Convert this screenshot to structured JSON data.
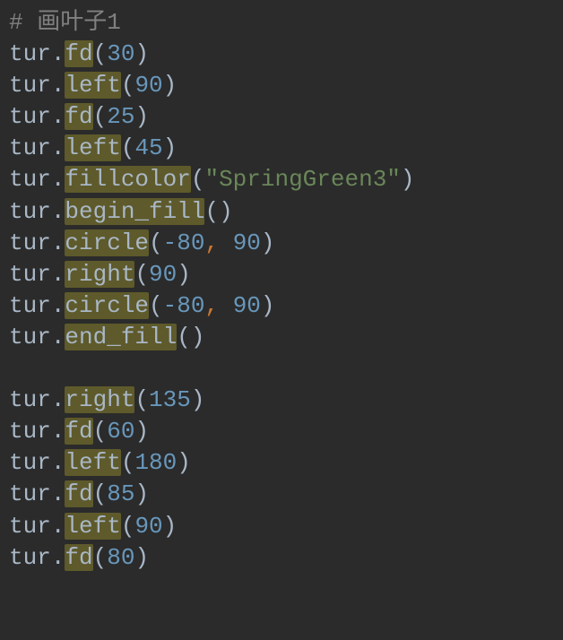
{
  "code": {
    "lines": [
      {
        "tokens": [
          {
            "t": "# 画叶子1",
            "c": "comment"
          }
        ]
      },
      {
        "tokens": [
          {
            "t": "tur",
            "c": "ident"
          },
          {
            "t": ".",
            "c": "dot"
          },
          {
            "t": "fd",
            "c": "method"
          },
          {
            "t": "(",
            "c": "paren"
          },
          {
            "t": "30",
            "c": "number"
          },
          {
            "t": ")",
            "c": "paren"
          }
        ]
      },
      {
        "tokens": [
          {
            "t": "tur",
            "c": "ident"
          },
          {
            "t": ".",
            "c": "dot"
          },
          {
            "t": "left",
            "c": "method"
          },
          {
            "t": "(",
            "c": "paren"
          },
          {
            "t": "90",
            "c": "number"
          },
          {
            "t": ")",
            "c": "paren"
          }
        ]
      },
      {
        "tokens": [
          {
            "t": "tur",
            "c": "ident"
          },
          {
            "t": ".",
            "c": "dot"
          },
          {
            "t": "fd",
            "c": "method"
          },
          {
            "t": "(",
            "c": "paren"
          },
          {
            "t": "25",
            "c": "number"
          },
          {
            "t": ")",
            "c": "paren"
          }
        ]
      },
      {
        "tokens": [
          {
            "t": "tur",
            "c": "ident"
          },
          {
            "t": ".",
            "c": "dot"
          },
          {
            "t": "left",
            "c": "method"
          },
          {
            "t": "(",
            "c": "paren"
          },
          {
            "t": "45",
            "c": "number"
          },
          {
            "t": ")",
            "c": "paren"
          }
        ]
      },
      {
        "tokens": [
          {
            "t": "tur",
            "c": "ident"
          },
          {
            "t": ".",
            "c": "dot"
          },
          {
            "t": "fillcolor",
            "c": "method"
          },
          {
            "t": "(",
            "c": "paren"
          },
          {
            "t": "\"SpringGreen3\"",
            "c": "string"
          },
          {
            "t": ")",
            "c": "paren"
          }
        ]
      },
      {
        "tokens": [
          {
            "t": "tur",
            "c": "ident"
          },
          {
            "t": ".",
            "c": "dot"
          },
          {
            "t": "begin_fill",
            "c": "method"
          },
          {
            "t": "(",
            "c": "paren"
          },
          {
            "t": ")",
            "c": "paren"
          }
        ]
      },
      {
        "tokens": [
          {
            "t": "tur",
            "c": "ident"
          },
          {
            "t": ".",
            "c": "dot"
          },
          {
            "t": "circle",
            "c": "method"
          },
          {
            "t": "(",
            "c": "paren"
          },
          {
            "t": "-80",
            "c": "number"
          },
          {
            "t": ",",
            "c": "comma"
          },
          {
            "t": " ",
            "c": "ident"
          },
          {
            "t": "90",
            "c": "number"
          },
          {
            "t": ")",
            "c": "paren"
          }
        ]
      },
      {
        "tokens": [
          {
            "t": "tur",
            "c": "ident"
          },
          {
            "t": ".",
            "c": "dot"
          },
          {
            "t": "right",
            "c": "method"
          },
          {
            "t": "(",
            "c": "paren"
          },
          {
            "t": "90",
            "c": "number"
          },
          {
            "t": ")",
            "c": "paren"
          }
        ]
      },
      {
        "tokens": [
          {
            "t": "tur",
            "c": "ident"
          },
          {
            "t": ".",
            "c": "dot"
          },
          {
            "t": "circle",
            "c": "method"
          },
          {
            "t": "(",
            "c": "paren"
          },
          {
            "t": "-80",
            "c": "number"
          },
          {
            "t": ",",
            "c": "comma"
          },
          {
            "t": " ",
            "c": "ident"
          },
          {
            "t": "90",
            "c": "number"
          },
          {
            "t": ")",
            "c": "paren"
          }
        ]
      },
      {
        "tokens": [
          {
            "t": "tur",
            "c": "ident"
          },
          {
            "t": ".",
            "c": "dot"
          },
          {
            "t": "end_fill",
            "c": "method"
          },
          {
            "t": "(",
            "c": "paren"
          },
          {
            "t": ")",
            "c": "paren"
          }
        ]
      },
      {
        "tokens": [
          {
            "t": " ",
            "c": "ident"
          }
        ]
      },
      {
        "tokens": [
          {
            "t": "tur",
            "c": "ident"
          },
          {
            "t": ".",
            "c": "dot"
          },
          {
            "t": "right",
            "c": "method"
          },
          {
            "t": "(",
            "c": "paren"
          },
          {
            "t": "135",
            "c": "number"
          },
          {
            "t": ")",
            "c": "paren"
          }
        ]
      },
      {
        "tokens": [
          {
            "t": "tur",
            "c": "ident"
          },
          {
            "t": ".",
            "c": "dot"
          },
          {
            "t": "fd",
            "c": "method"
          },
          {
            "t": "(",
            "c": "paren"
          },
          {
            "t": "60",
            "c": "number"
          },
          {
            "t": ")",
            "c": "paren"
          }
        ]
      },
      {
        "tokens": [
          {
            "t": "tur",
            "c": "ident"
          },
          {
            "t": ".",
            "c": "dot"
          },
          {
            "t": "left",
            "c": "method"
          },
          {
            "t": "(",
            "c": "paren"
          },
          {
            "t": "180",
            "c": "number"
          },
          {
            "t": ")",
            "c": "paren"
          }
        ]
      },
      {
        "tokens": [
          {
            "t": "tur",
            "c": "ident"
          },
          {
            "t": ".",
            "c": "dot"
          },
          {
            "t": "fd",
            "c": "method"
          },
          {
            "t": "(",
            "c": "paren"
          },
          {
            "t": "85",
            "c": "number"
          },
          {
            "t": ")",
            "c": "paren"
          }
        ]
      },
      {
        "tokens": [
          {
            "t": "tur",
            "c": "ident"
          },
          {
            "t": ".",
            "c": "dot"
          },
          {
            "t": "left",
            "c": "method"
          },
          {
            "t": "(",
            "c": "paren"
          },
          {
            "t": "90",
            "c": "number"
          },
          {
            "t": ")",
            "c": "paren"
          }
        ]
      },
      {
        "tokens": [
          {
            "t": "tur",
            "c": "ident"
          },
          {
            "t": ".",
            "c": "dot"
          },
          {
            "t": "fd",
            "c": "method"
          },
          {
            "t": "(",
            "c": "paren"
          },
          {
            "t": "80",
            "c": "number"
          },
          {
            "t": ")",
            "c": "paren"
          }
        ]
      }
    ]
  }
}
